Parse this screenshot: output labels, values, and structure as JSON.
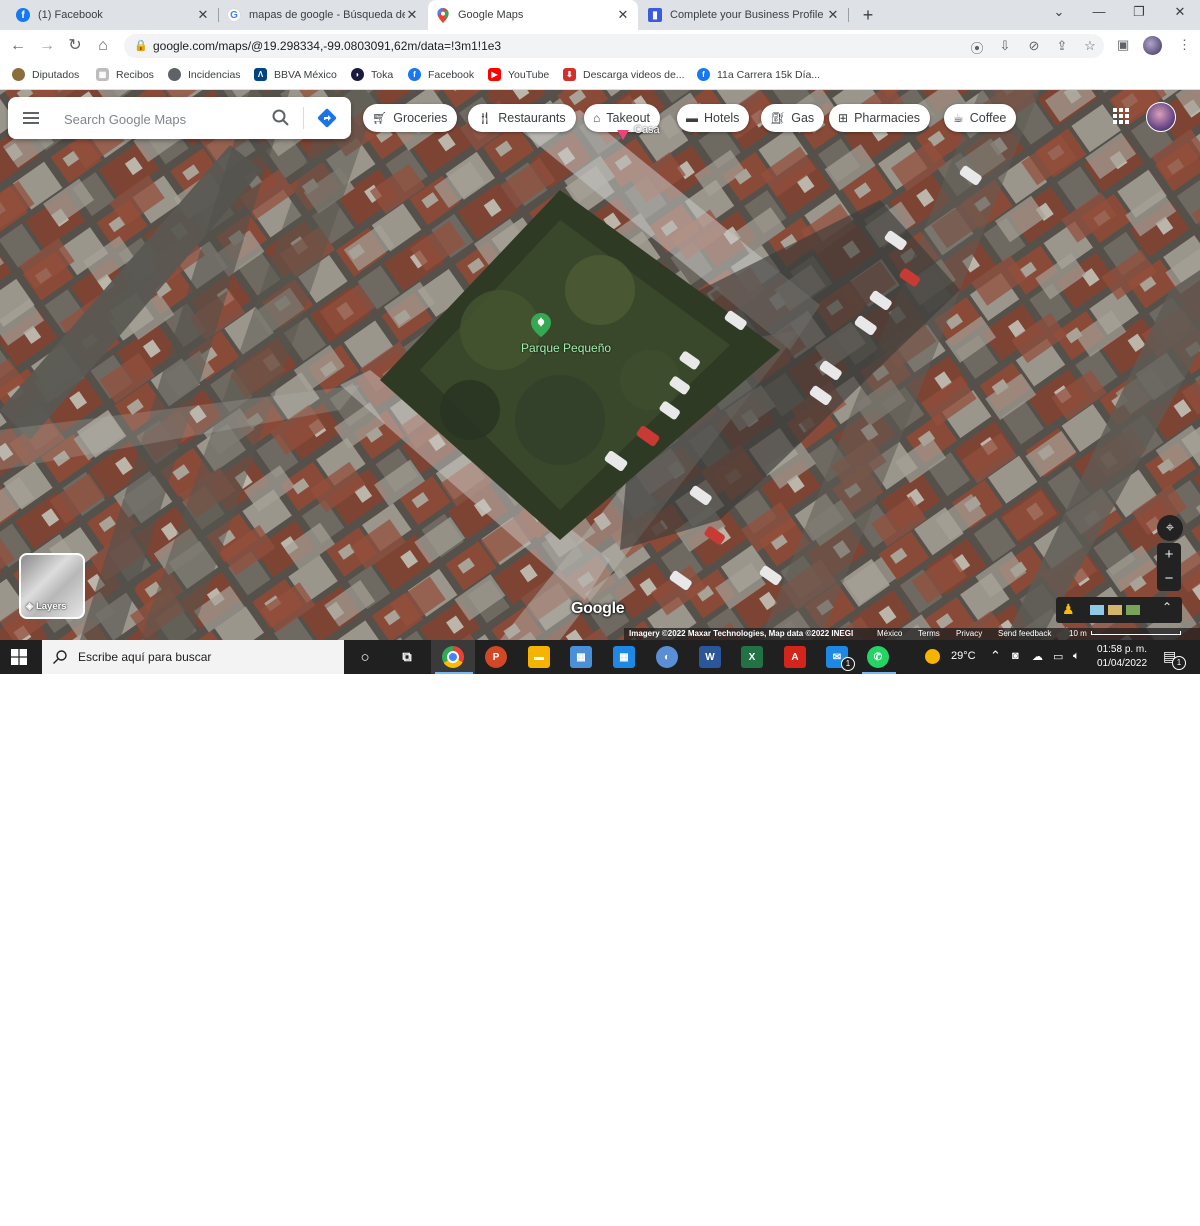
{
  "browser": {
    "tabs": [
      {
        "title": "(1) Facebook",
        "icon": "facebook-icon",
        "active": false
      },
      {
        "title": "mapas de google - Búsqueda de",
        "icon": "google-g-icon",
        "active": false
      },
      {
        "title": "Google Maps",
        "icon": "google-maps-pin-icon",
        "active": true
      },
      {
        "title": "Complete your Business Profile",
        "icon": "business-profile-icon",
        "active": false
      }
    ],
    "url": "google.com/maps/@19.298334,-99.0803091,62m/data=!3m1!1e3",
    "bookmarks": [
      {
        "label": "Diputados",
        "icon": "diputados-icon"
      },
      {
        "label": "Recibos",
        "icon": "recibos-icon"
      },
      {
        "label": "Incidencias",
        "icon": "globe-icon"
      },
      {
        "label": "BBVA México",
        "icon": "bbva-icon"
      },
      {
        "label": "Toka",
        "icon": "toka-icon"
      },
      {
        "label": "Facebook",
        "icon": "facebook-icon"
      },
      {
        "label": "YouTube",
        "icon": "youtube-icon"
      },
      {
        "label": "Descarga videos de...",
        "icon": "download-icon"
      },
      {
        "label": "11a Carrera 15k Día...",
        "icon": "facebook-icon"
      }
    ]
  },
  "maps": {
    "search_placeholder": "Search Google Maps",
    "chips": [
      "Groceries",
      "Restaurants",
      "Takeout",
      "Hotels",
      "Gas",
      "Pharmacies",
      "Coffee"
    ],
    "place_label": "Parque Pequeño",
    "top_pin_label": "Casa",
    "layers_label": "Layers",
    "google_logo": "Google",
    "attribution": {
      "imagery": "Imagery ©2022 Maxar Technologies, Map data ©2022 INEGI",
      "region": "México",
      "terms": "Terms",
      "privacy": "Privacy",
      "feedback": "Send feedback",
      "scale": "10 m"
    },
    "zoom_in": "+",
    "zoom_out": "−"
  },
  "taskbar": {
    "search_text": "Escribe aquí para buscar",
    "temperature": "29°C",
    "time": "01:58 p. m.",
    "date": "01/04/2022",
    "mail_badge": "1",
    "notification_badge": "1"
  }
}
